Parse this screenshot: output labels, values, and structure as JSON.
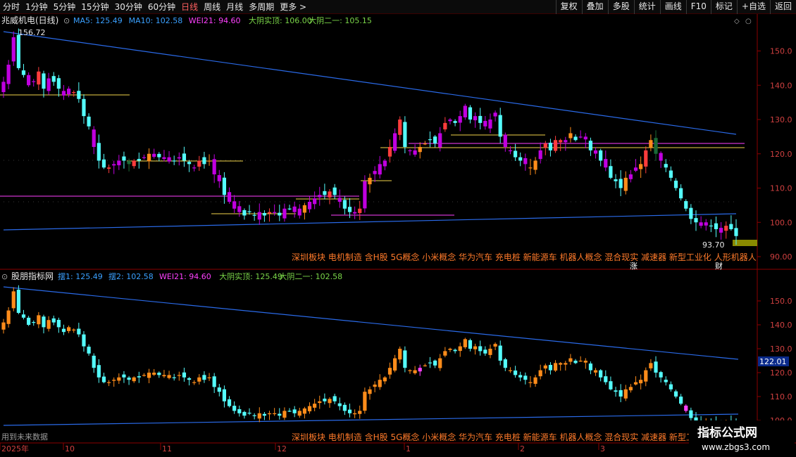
{
  "toolbar": {
    "periods": [
      "分时",
      "1分钟",
      "5分钟",
      "15分钟",
      "30分钟",
      "60分钟",
      "日线",
      "周线",
      "月线",
      "多周期",
      "更多 >"
    ],
    "active_period": "日线",
    "buttons": [
      "复权",
      "叠加",
      "多股",
      "统计",
      "画线",
      "F10",
      "标记",
      "+自选",
      "返回"
    ]
  },
  "main_panel": {
    "title": "兆威机电(日线)",
    "indicators": [
      {
        "label": "MA5: 125.49",
        "color": "#3aa0ff"
      },
      {
        "label": "MA10: 102.58",
        "color": "#3aa0ff"
      },
      {
        "label": "WEI21: 94.60",
        "color": "#ff40ff"
      },
      {
        "label": "大阴实顶: 106.00",
        "color": "#7ad548"
      },
      {
        "label": "大阴二一: 105.15",
        "color": "#7ad548"
      }
    ],
    "high_label": "156.72",
    "low_label": "93.70",
    "y_ticks": [
      "150.0",
      "140.0",
      "130.0",
      "120.0",
      "110.0",
      "100.0",
      "90.00"
    ],
    "concepts": "深圳板块 电机制造 含H股 5G概念 小米概念 华为汽车 充电桩 新能源车 机器人概念 混合现实 减速器 新型工业化 人形机器人",
    "badge_zhang": "涨",
    "badge_cai": "财"
  },
  "sub_panel": {
    "title": "股朋指标网",
    "indicators": [
      {
        "label": "摆1: 125.49",
        "color": "#3aa0ff"
      },
      {
        "label": "摆2: 102.58",
        "color": "#3aa0ff"
      },
      {
        "label": "WEI21: 94.60",
        "color": "#ff40ff"
      },
      {
        "label": "大阴实顶: 125.49",
        "color": "#7ad548"
      },
      {
        "label": "大阴二一: 102.58",
        "color": "#7ad548"
      }
    ],
    "y_ticks": [
      "150.0",
      "140.0",
      "130.0",
      "120.0",
      "110.0",
      "100.0"
    ],
    "current_value": "122.01",
    "concepts": "深圳板块 电机制造 含H股 5G概念 小米概念 华为汽车 充电桩 新能源车 机器人概念 混合现实 减速器 新型工",
    "future_note": "用到未来数据"
  },
  "x_axis": {
    "labels": [
      "2025年",
      "10",
      "11",
      "12",
      "1",
      "2",
      "3"
    ]
  },
  "watermark": {
    "line1": "指标公式网",
    "line2": "www.zbgs3.com"
  },
  "colors": {
    "up": "#ff3c3c",
    "down": "#54fcfc",
    "purple": "#c000e0",
    "magenta": "#ff40ff",
    "orange": "#ff8c1a",
    "green_dark": "#1a6a36",
    "trend": "#2a6ae8",
    "yellow": "#f2d44a",
    "axis_red": "#8b0000",
    "label_blue": "#3aa0ff",
    "label_green": "#7ad548"
  },
  "chart_data": {
    "type": "candlestick",
    "x_labels": [
      "2025年",
      "10",
      "11",
      "12",
      "1",
      "2",
      "3"
    ],
    "ylim": [
      90,
      160
    ],
    "close": [
      141,
      146,
      154,
      145,
      143,
      140,
      141,
      144,
      139,
      142,
      141,
      139,
      137,
      139,
      138,
      136,
      131,
      128,
      122,
      118,
      116,
      116,
      117,
      118,
      118,
      117,
      118,
      118,
      119,
      120,
      120,
      119,
      119,
      119,
      118,
      119,
      118,
      117,
      116,
      118,
      117,
      118,
      114,
      112,
      108,
      106,
      104,
      103,
      102,
      103,
      102,
      103,
      102,
      103,
      103,
      102,
      104,
      104,
      103,
      104,
      105,
      106,
      107,
      108,
      108,
      109,
      108,
      106,
      104,
      103,
      103,
      104,
      112,
      113,
      115,
      117,
      118,
      122,
      126,
      130,
      122,
      121,
      121,
      122,
      123,
      124,
      123,
      126,
      129,
      130,
      129,
      131,
      134,
      130,
      131,
      129,
      128,
      130,
      132,
      125,
      122,
      121,
      119,
      118,
      117,
      116,
      118,
      121,
      123,
      121,
      124,
      124,
      124,
      126,
      124,
      125,
      125,
      121,
      121,
      118,
      116,
      113,
      112,
      110,
      113,
      114,
      116,
      117,
      121,
      124,
      120,
      118,
      116,
      113,
      110,
      107,
      104,
      101,
      100,
      99,
      100,
      99,
      98,
      97,
      99,
      98,
      96
    ]
  }
}
